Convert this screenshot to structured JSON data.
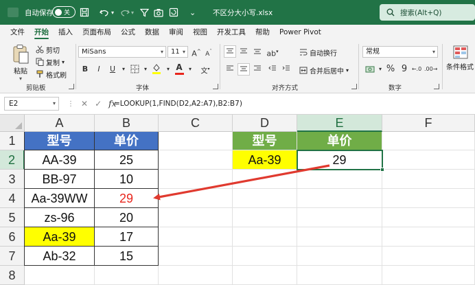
{
  "titlebar": {
    "autosave_label": "自动保存",
    "autosave_state": "关",
    "filename": "不区分大小写.xlsx",
    "search_placeholder": "搜索(Alt+Q)"
  },
  "tabs": [
    "文件",
    "开始",
    "插入",
    "页面布局",
    "公式",
    "数据",
    "审阅",
    "视图",
    "开发工具",
    "帮助",
    "Power Pivot"
  ],
  "active_tab": "开始",
  "ribbon": {
    "clipboard": {
      "paste": "粘贴",
      "cut": "剪切",
      "copy": "复制",
      "format_painter": "格式刷",
      "label": "剪贴板"
    },
    "font": {
      "name": "MiSans",
      "size": "11",
      "label": "字体",
      "bold": "B",
      "italic": "I",
      "underline": "U",
      "font_color_glyph": "A",
      "font_color": "#e8251c",
      "fill_color": "#ffff00"
    },
    "alignment": {
      "wrap": "自动换行",
      "merge": "合并后居中",
      "label": "对齐方式"
    },
    "number": {
      "format": "常规",
      "label": "数字"
    },
    "styles": {
      "conditional": "条件格式"
    }
  },
  "formula_bar": {
    "name_box": "E2",
    "fx": "fx",
    "formula": "=LOOKUP(1,FIND(D2,A2:A7),B2:B7)"
  },
  "sheet": {
    "columns": [
      "A",
      "B",
      "C",
      "D",
      "E",
      "F"
    ],
    "rows": [
      "1",
      "2",
      "3",
      "4",
      "5",
      "6",
      "7",
      "8"
    ],
    "selected_cell": "E2",
    "table1": {
      "headers": [
        "型号",
        "单价"
      ],
      "rows": [
        [
          "AA-39",
          "25"
        ],
        [
          "BB-97",
          "10"
        ],
        [
          "Aa-39WW",
          "29"
        ],
        [
          "zs-96",
          "20"
        ],
        [
          "Aa-39",
          "17"
        ],
        [
          "Ab-32",
          "15"
        ]
      ]
    },
    "table2": {
      "headers": [
        "型号",
        "单价"
      ],
      "row": [
        "Aa-39",
        "29"
      ]
    },
    "colors": {
      "header_blue": "#4472c4",
      "header_green": "#70ad47",
      "highlight_yellow": "#ffff00",
      "highlight_red_text": "#e8251c",
      "accent_green": "#217346"
    }
  }
}
